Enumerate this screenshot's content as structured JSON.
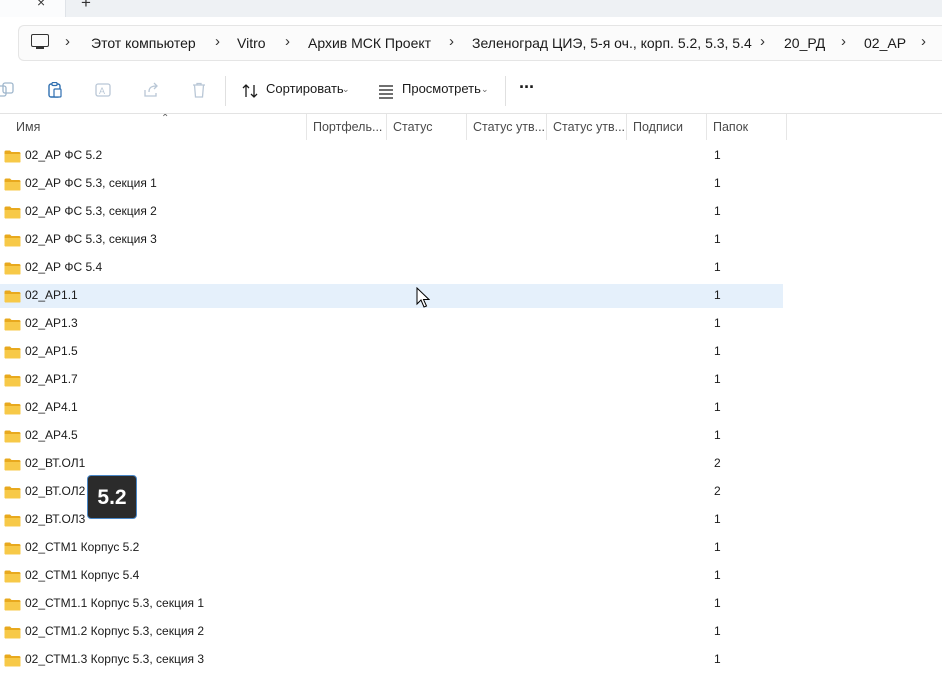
{
  "tabs": {
    "close_glyph": "×",
    "add_glyph": "+"
  },
  "breadcrumb": [
    "Этот компьютер",
    "Vitro",
    "Архив МСК Проект",
    "Зеленоград ЦИЭ, 5-я оч., корп. 5.2, 5.3, 5.4",
    "20_РД",
    "02_АР"
  ],
  "toolbar": {
    "sort_label": "Сортировать",
    "view_label": "Просмотреть",
    "more_label": "···"
  },
  "columns": [
    "Имя",
    "Портфель...",
    "Статус",
    "Статус утв...",
    "Статус утв...",
    "Подписи",
    "Папок"
  ],
  "rows": [
    {
      "name": "02_АР ФС 5.2",
      "folders": "1"
    },
    {
      "name": "02_АР ФС 5.3, секция 1",
      "folders": "1"
    },
    {
      "name": "02_АР ФС 5.3, секция 2",
      "folders": "1"
    },
    {
      "name": "02_АР ФС 5.3, секция 3",
      "folders": "1"
    },
    {
      "name": "02_АР ФС 5.4",
      "folders": "1"
    },
    {
      "name": "02_АР1.1",
      "folders": "1",
      "selected": true
    },
    {
      "name": "02_АР1.3",
      "folders": "1"
    },
    {
      "name": "02_АР1.5",
      "folders": "1"
    },
    {
      "name": "02_АР1.7",
      "folders": "1"
    },
    {
      "name": "02_АР4.1",
      "folders": "1"
    },
    {
      "name": "02_АР4.5",
      "folders": "1"
    },
    {
      "name": "02_ВТ.ОЛ1",
      "folders": "2"
    },
    {
      "name": "02_ВТ.ОЛ2",
      "folders": "2"
    },
    {
      "name": "02_ВТ.ОЛ3",
      "folders": "1"
    },
    {
      "name": "02_СТМ1 Корпус 5.2",
      "folders": "1"
    },
    {
      "name": "02_СТМ1 Корпус 5.4",
      "folders": "1"
    },
    {
      "name": "02_СТМ1.1 Корпус 5.3, секция 1",
      "folders": "1"
    },
    {
      "name": "02_СТМ1.2 Корпус 5.3, секция 2",
      "folders": "1"
    },
    {
      "name": "02_СТМ1.3 Корпус 5.3, секция 3",
      "folders": "1"
    }
  ],
  "overlay_badge": "5.2",
  "colors": {
    "selected_row": "#e5f0fb",
    "folder_yellow": "#f4c441",
    "badge_bg": "#2b2b2b",
    "badge_border": "#4a88c8"
  }
}
